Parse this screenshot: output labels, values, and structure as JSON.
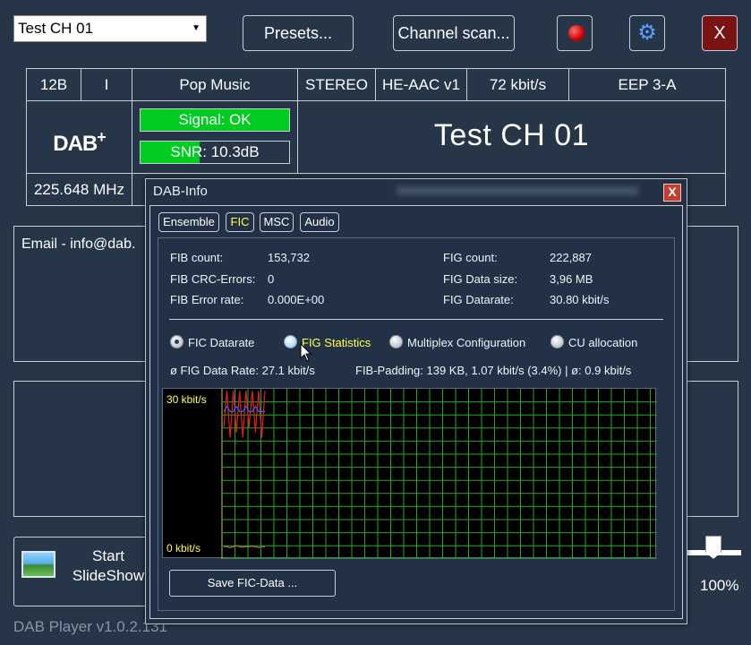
{
  "toolbar": {
    "channel_value": "Test CH 01",
    "presets_label": "Presets...",
    "scan_label": "Channel scan...",
    "close_label": "X"
  },
  "info": {
    "block": "12B",
    "marker": "I",
    "genre": "Pop Music",
    "mode": "STEREO",
    "codec": "HE-AAC v1",
    "bitrate": "72 kbit/s",
    "protection": "EEP 3-A",
    "logo_text": "DAB",
    "logo_plus": "+",
    "signal_text": "Signal: OK",
    "signal_level": 1.0,
    "snr_text": "SNR: 10.3dB",
    "snr_level": 0.4,
    "station": "Test CH 01",
    "frequency": "225.648 MHz"
  },
  "main": {
    "email_text": "Email - info@dab.",
    "slideshow_label_1": "Start",
    "slideshow_label_2": "SlideShow",
    "volume_text": "100%",
    "volume_level": 1.0,
    "version": "DAB Player v1.0.2.131"
  },
  "dialog": {
    "title": "DAB-Info",
    "close_label": "X",
    "tabs": [
      "Ensemble",
      "FIC",
      "MSC",
      "Audio"
    ],
    "active_tab": "FIC",
    "stats_left": [
      {
        "label": "FIB count:",
        "value": "153,732"
      },
      {
        "label": "FIB CRC-Errors:",
        "value": "0"
      },
      {
        "label": "FIB Error rate:",
        "value": "0.000E+00"
      }
    ],
    "stats_right": [
      {
        "label": "FIG count:",
        "value": "222,887"
      },
      {
        "label": "FIG Data size:",
        "value": "3,96 MB"
      },
      {
        "label": "FIG Datarate:",
        "value": "30.80 kbit/s"
      }
    ],
    "radios": [
      "FIC Datarate",
      "FIG Statistics",
      "Multiplex Configuration",
      "CU allocation"
    ],
    "selected_radio": "FIC Datarate",
    "avg_rate": "ø FIG Data Rate: 27.1 kbit/s",
    "padding_info": "FIB-Padding: 139 KB, 1.07 kbit/s (3.4%) | ø: 0.9 kbit/s",
    "save_label": "Save FIC-Data ...",
    "colors": {
      "grid": "#22aa22",
      "highlight": "#ffff50",
      "bg": "#000000"
    }
  },
  "chart_data": {
    "type": "line",
    "y_tick_labels": [
      "30 kbit/s",
      "0 kbit/s"
    ],
    "ylim": [
      0,
      30
    ],
    "grid": true,
    "series": [
      {
        "color": "#e02020",
        "values": [
          24,
          31,
          22,
          31,
          23,
          31,
          22,
          31,
          24,
          31,
          23,
          31,
          22,
          31
        ]
      },
      {
        "color": "#4060ff",
        "values": [
          27,
          28,
          27,
          27,
          28,
          27,
          27,
          28,
          27,
          27,
          28,
          27,
          27,
          27
        ]
      },
      {
        "color": "#c07050",
        "values": [
          1,
          1,
          0.8,
          1,
          1.2,
          1,
          0.9,
          1,
          1,
          1.1,
          1,
          0.8,
          1,
          1
        ]
      }
    ]
  }
}
